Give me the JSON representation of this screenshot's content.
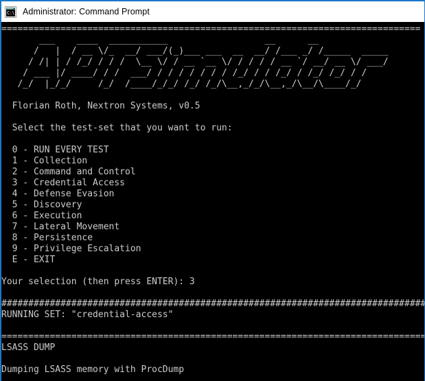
{
  "window": {
    "title": "Administrator: Command Prompt",
    "icon": "cmd-console-icon",
    "icon_glyph": "C:\\",
    "border_color": "#1a78c8",
    "titlebar_bg": "#ffffff",
    "console_bg": "#000000",
    "console_fg": "#cccccc"
  },
  "console": {
    "rule_equals_top": "==============================================================================",
    "banner": [
      "       ___    ____  ___________                  __      __",
      "      /   |  / __ \\/_  __/ ___/(_)___ ___  __  __/ /___ _/ /_____  _____",
      "     / /| | / /_/ / / /  \\__ \\/ / __ `__ \\/ / / / / __ `/ __/ __ \\/ ___/",
      "    / ___ |/ ____/ / /  ___/ / / / / / / / /_/ / / /_/ / /_/ /_/ / /",
      "   /_/  |_/_/     /_/  /____/_/_/ /_/ /_/\\__,_/_/\\__,_/\\__/\\____/_/"
    ],
    "author_line": "  Florian Roth, Nextron Systems, v0.5",
    "prompt_line": "  Select the test-set that you want to run:",
    "menu": [
      {
        "key": "0",
        "label": "RUN EVERY TEST"
      },
      {
        "key": "1",
        "label": "Collection"
      },
      {
        "key": "2",
        "label": "Command and Control"
      },
      {
        "key": "3",
        "label": "Credential Access"
      },
      {
        "key": "4",
        "label": "Defense Evasion"
      },
      {
        "key": "5",
        "label": "Discovery"
      },
      {
        "key": "6",
        "label": "Execution"
      },
      {
        "key": "7",
        "label": "Lateral Movement"
      },
      {
        "key": "8",
        "label": "Persistence"
      },
      {
        "key": "9",
        "label": "Privilege Escalation"
      },
      {
        "key": "E",
        "label": "EXIT"
      }
    ],
    "selection_prompt": "Your selection (then press ENTER): ",
    "selection_value": "3",
    "rule_hashes": "################################################################################",
    "running_set_line": "RUNNING SET: \"credential-access\"",
    "rule_equals_section": "================================================================================",
    "section_title": "LSASS DUMP",
    "status_line": "Dumping LSASS memory with ProcDump"
  }
}
